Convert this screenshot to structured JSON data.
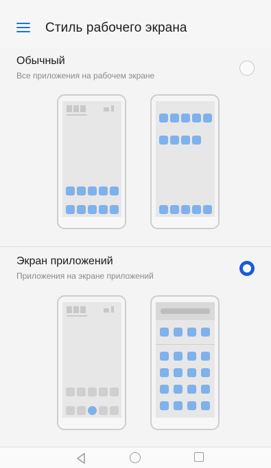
{
  "header": {
    "title": "Стиль рабочего экрана",
    "menu_icon": "hamburger-menu-icon",
    "accent_color": "#1a73e8"
  },
  "options": [
    {
      "title": "Обычный",
      "description": "Все приложения на рабочем экране",
      "selected": false
    },
    {
      "title": "Экран приложений",
      "description": "Приложения на экране приложений",
      "selected": true
    }
  ],
  "navbar": {
    "back_icon": "back-triangle-icon",
    "home_icon": "home-circle-icon",
    "recent_icon": "recent-square-icon"
  }
}
